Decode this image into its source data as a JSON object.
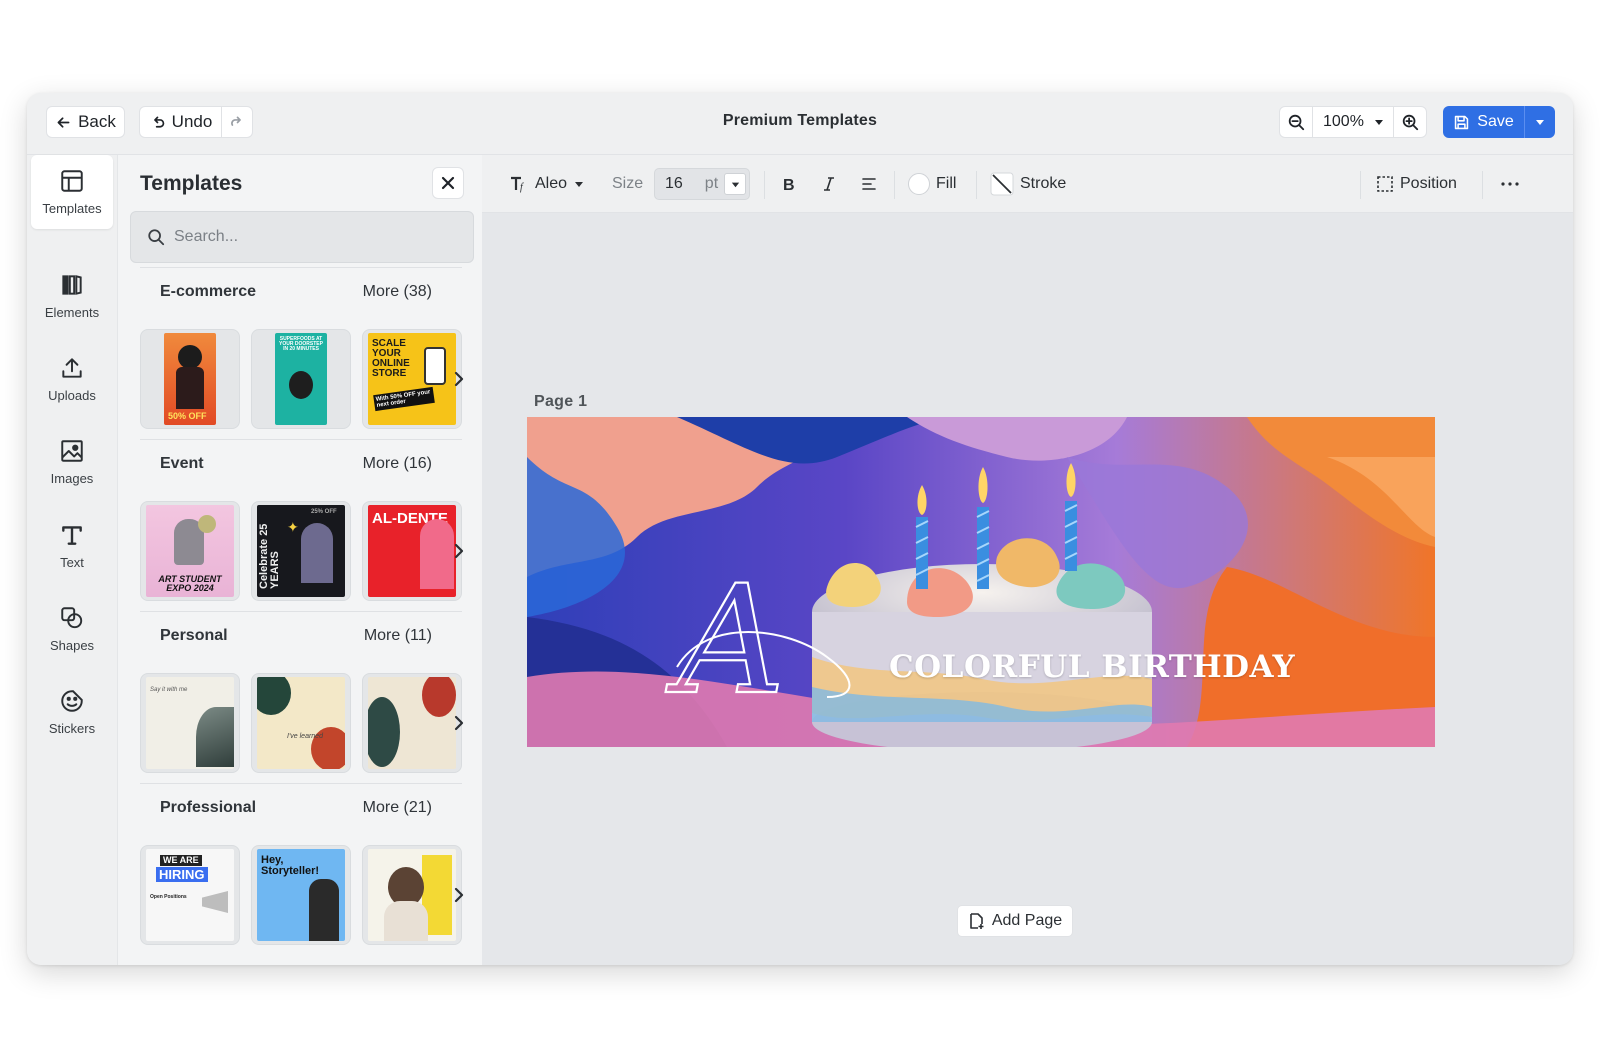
{
  "header": {
    "back_label": "Back",
    "undo_label": "Undo",
    "title": "Premium Templates",
    "zoom": "100%",
    "save_label": "Save"
  },
  "rail": {
    "items": [
      {
        "label": "Templates",
        "icon": "layout-icon"
      },
      {
        "label": "Elements",
        "icon": "elements-icon"
      },
      {
        "label": "Uploads",
        "icon": "upload-icon"
      },
      {
        "label": "Images",
        "icon": "image-icon"
      },
      {
        "label": "Text",
        "icon": "text-icon"
      },
      {
        "label": "Shapes",
        "icon": "shapes-icon"
      },
      {
        "label": "Stickers",
        "icon": "sticker-icon"
      }
    ]
  },
  "panel": {
    "title": "Templates",
    "search_placeholder": "Search...",
    "sections": [
      {
        "name": "E-commerce",
        "more": "More (38)",
        "thumb_texts": [
          [
            "50% OFF"
          ],
          [
            "SUPERFOODS AT YOUR DOORSTEP IN 20 MINUTES"
          ],
          [
            "SCALE YOUR ONLINE STORE",
            "With 50% OFF your next order"
          ]
        ]
      },
      {
        "name": "Event",
        "more": "More (16)",
        "thumb_texts": [
          [
            "ART STUDENT EXPO 2024"
          ],
          [
            "Celebrate 25 YEARS",
            "25% OFF"
          ],
          [
            "AL-DENTE"
          ]
        ]
      },
      {
        "name": "Personal",
        "more": "More (11)",
        "thumb_texts": [
          [
            "Say it with me"
          ],
          [
            "I've learned"
          ],
          [
            ""
          ]
        ]
      },
      {
        "name": "Professional",
        "more": "More (21)",
        "thumb_texts": [
          [
            "WE ARE",
            "HIRING",
            "Open Positions"
          ],
          [
            "Hey, Storyteller!"
          ],
          [
            ""
          ]
        ]
      }
    ]
  },
  "toolbar": {
    "font": "Aleo",
    "size_label": "Size",
    "size_value": "16",
    "size_unit": "pt",
    "fill_label": "Fill",
    "stroke_label": "Stroke",
    "position_label": "Position"
  },
  "canvas": {
    "page_label": "Page  1",
    "banner_text": "COLORFUL BIRTHDAY",
    "script_letter": "A",
    "add_page_label": "Add Page"
  },
  "colors": {
    "accent": "#2f6fe4",
    "background": "#e5e7ea"
  }
}
